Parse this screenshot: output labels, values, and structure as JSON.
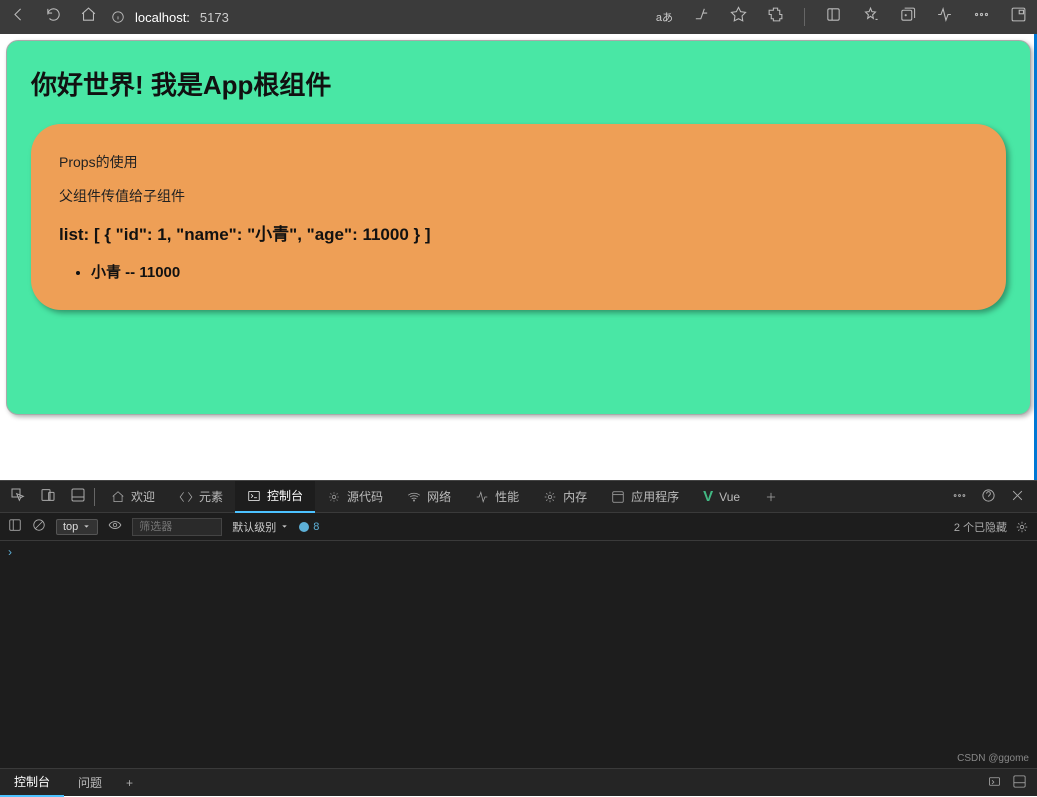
{
  "browser": {
    "url_host": "localhost:",
    "url_port": "5173",
    "reading_badge": "aあ"
  },
  "page": {
    "app_title": "你好世界! 我是App根组件",
    "props_heading": "Props的使用",
    "props_desc": "父组件传值给子组件",
    "list_label": "list: [ { \"id\": 1, \"name\": \"小青\", \"age\": 11000 } ]",
    "items": [
      {
        "name": "小青",
        "age": 11000
      }
    ]
  },
  "devtools": {
    "tabs": {
      "welcome": "欢迎",
      "elements": "元素",
      "console": "控制台",
      "sources": "源代码",
      "network": "网络",
      "performance": "性能",
      "memory": "内存",
      "application": "应用程序",
      "vue": "Vue"
    },
    "filter": {
      "scope": "top",
      "placeholder": "筛选器",
      "level": "默认级别",
      "issues_count": "8",
      "hidden_text": "2 个已隐藏"
    },
    "bottom": {
      "console": "控制台",
      "issues": "问题"
    }
  },
  "watermark": "CSDN @ggome"
}
